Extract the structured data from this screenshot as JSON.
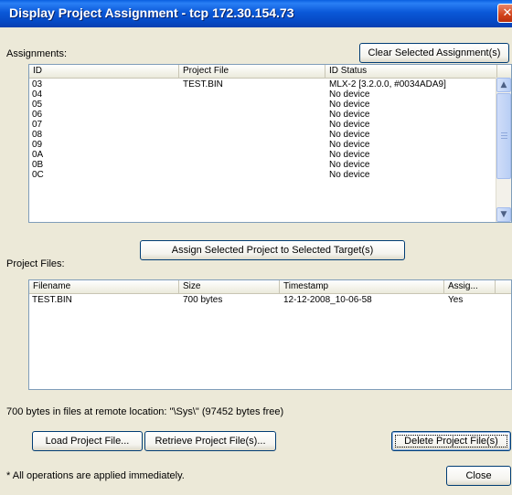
{
  "window": {
    "title": "Display Project Assignment - tcp 172.30.154.73",
    "close_glyph": "✕"
  },
  "assignments": {
    "label": "Assignments:",
    "clear_button": "Clear Selected Assignment(s)",
    "columns": [
      "ID",
      "Project File",
      "ID Status"
    ],
    "rows": [
      {
        "id": "03",
        "project_file": "TEST.BIN",
        "status": "MLX-2 [3.2.0.0, #0034ADA9]"
      },
      {
        "id": "04",
        "project_file": "",
        "status": "No device"
      },
      {
        "id": "05",
        "project_file": "",
        "status": "No device"
      },
      {
        "id": "06",
        "project_file": "",
        "status": "No device"
      },
      {
        "id": "07",
        "project_file": "",
        "status": "No device"
      },
      {
        "id": "08",
        "project_file": "",
        "status": "No device"
      },
      {
        "id": "09",
        "project_file": "",
        "status": "No device"
      },
      {
        "id": "0A",
        "project_file": "",
        "status": "No device"
      },
      {
        "id": "0B",
        "project_file": "",
        "status": "No device"
      },
      {
        "id": "0C",
        "project_file": "",
        "status": "No device"
      }
    ],
    "scroll_up_glyph": "▲",
    "scroll_down_glyph": "▼"
  },
  "assign_button": "Assign Selected Project to Selected Target(s)",
  "project_files": {
    "label": "Project Files:",
    "columns": [
      "Filename",
      "Size",
      "Timestamp",
      "Assig..."
    ],
    "rows": [
      {
        "filename": "TEST.BIN",
        "size": "700 bytes",
        "timestamp": "12-12-2008_10-06-58",
        "assigned": "Yes"
      }
    ]
  },
  "remote_info": "700 bytes in files at remote location: \"\\Sys\\\" (97452 bytes free)",
  "buttons": {
    "load": "Load Project File...",
    "retrieve": "Retrieve Project File(s)...",
    "delete": "Delete Project File(s)",
    "close": "Close"
  },
  "footer_note": "* All operations are applied immediately."
}
